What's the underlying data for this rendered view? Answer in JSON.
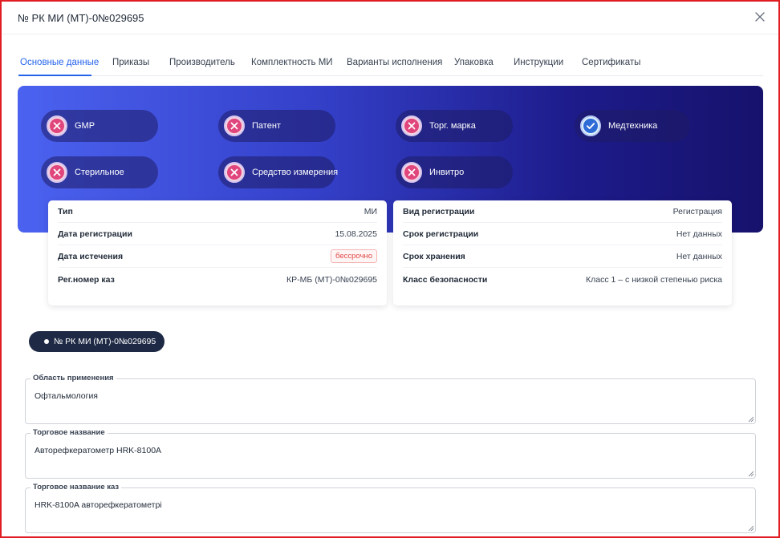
{
  "modal": {
    "title": "№ РК МИ (МТ)-0№029695"
  },
  "tabs": [
    {
      "label": "Основные данные",
      "active": true
    },
    {
      "label": "Приказы"
    },
    {
      "label": "Производитель"
    },
    {
      "label": "Комплектность МИ"
    },
    {
      "label": "Варианты исполнения"
    },
    {
      "label": "Упаковка"
    },
    {
      "label": "Инструкции"
    },
    {
      "label": "Сертификаты"
    }
  ],
  "flags": [
    {
      "label": "GMP",
      "status": "no"
    },
    {
      "label": "Патент",
      "status": "no"
    },
    {
      "label": "Торг. марка",
      "status": "no"
    },
    {
      "label": "Медтехника",
      "status": "yes"
    },
    {
      "label": "Стерильное",
      "status": "no"
    },
    {
      "label": "Средство измерения",
      "status": "no"
    },
    {
      "label": "Инвитро",
      "status": "no"
    }
  ],
  "left_card": [
    {
      "key": "Тип",
      "value": "МИ"
    },
    {
      "key": "Дата регистрации",
      "value": "15.08.2025"
    },
    {
      "key": "Дата истечения",
      "value": "бессрочно"
    },
    {
      "key": "Рег.номер каз",
      "value": "КР-МБ (МТ)-0№029695"
    }
  ],
  "right_card": [
    {
      "key": "Вид регистрации",
      "value": "Регистрация"
    },
    {
      "key": "Срок регистрации",
      "value": "Нет данных"
    },
    {
      "key": "Срок хранения",
      "value": "Нет данных"
    },
    {
      "key": "Класс безопасности",
      "value": "Класс 1 – с низкой степенью риска"
    }
  ],
  "registration_pill": "№ РК МИ (МТ)-0№029695",
  "fields": [
    {
      "label": "Область применения",
      "value": "Офтальмология"
    },
    {
      "label": "Торговое название",
      "value": "Авторефкератометр HRK-8100A"
    },
    {
      "label": "Торговое название каз",
      "value": "HRK-8100A авторефкератометрі"
    }
  ],
  "colors": {
    "accent": "#2563eb",
    "frame": "#e11d24",
    "banner_start": "#4b62f0",
    "banner_end": "#16126c",
    "pill_dark": "#1e2a45",
    "badge_no": "#e0457b",
    "badge_yes": "#2d6bd6",
    "expiry_tag": "#e04848"
  },
  "icons": {
    "close": "close-icon",
    "no": "x-circle-icon",
    "yes": "check-circle-icon"
  }
}
